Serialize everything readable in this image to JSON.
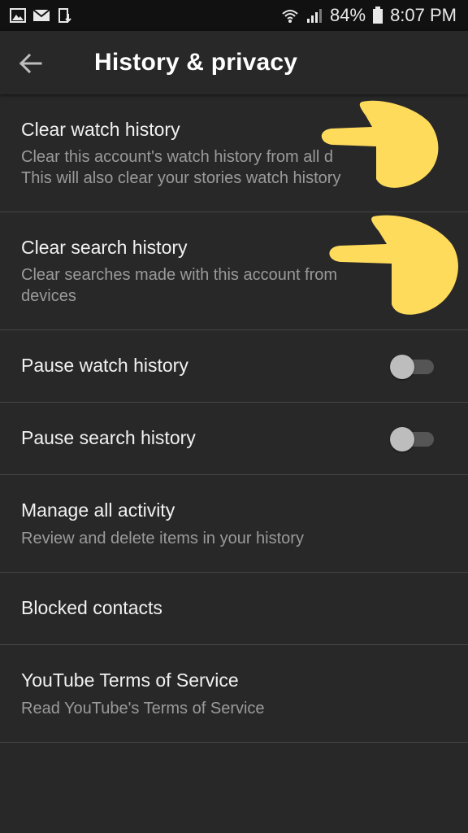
{
  "status_bar": {
    "battery": "84%",
    "time": "8:07 PM"
  },
  "header": {
    "title": "History & privacy"
  },
  "items": [
    {
      "title": "Clear watch history",
      "subtitle": "Clear this account's watch history from all d\nThis will also clear your stories watch history"
    },
    {
      "title": "Clear search history",
      "subtitle": "Clear searches made with this account from\ndevices"
    },
    {
      "title": "Pause watch history",
      "toggle": false
    },
    {
      "title": "Pause search history",
      "toggle": false
    },
    {
      "title": "Manage all activity",
      "subtitle": "Review and delete items in your history"
    },
    {
      "title": "Blocked contacts"
    },
    {
      "title": "YouTube Terms of Service",
      "subtitle": "Read YouTube's Terms of Service"
    }
  ],
  "colors": {
    "background": "#282828",
    "status_bar": "#111111",
    "divider": "#454545",
    "annotation_hand": "#FFDB5C"
  },
  "icons": [
    "image-icon",
    "mail-icon",
    "download-icon",
    "wifi-icon",
    "signal-icon",
    "battery-icon",
    "arrow-back-icon",
    "pointing-hand-icon"
  ]
}
